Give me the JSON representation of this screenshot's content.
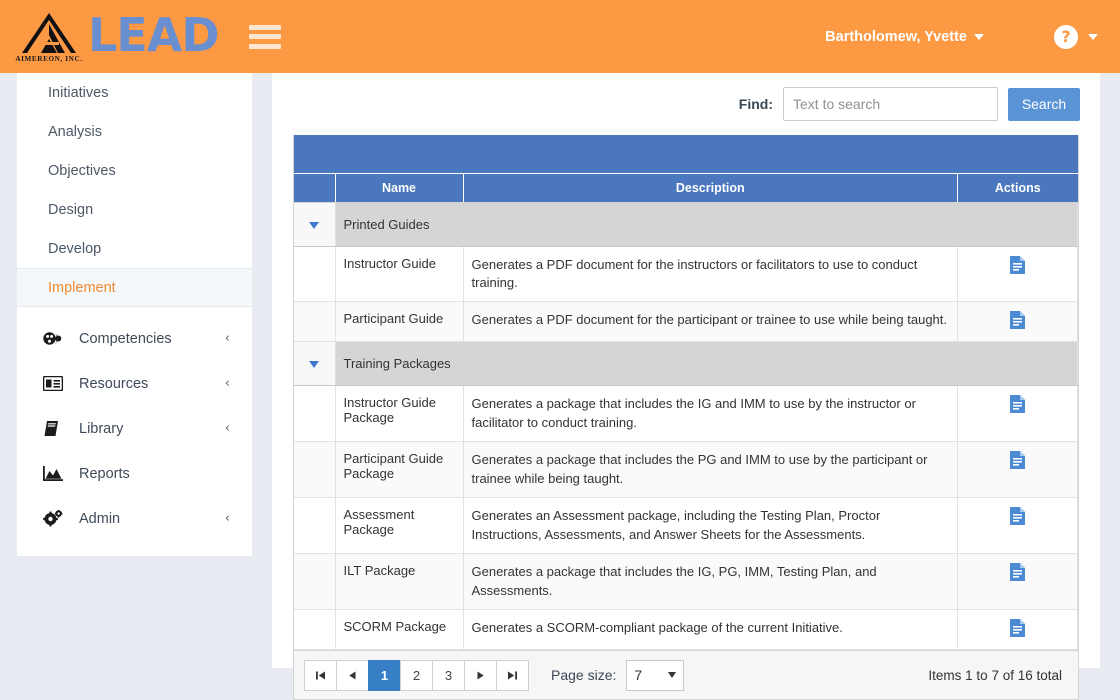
{
  "header": {
    "logo_word": "LEAD",
    "logo_company": "AIMEREON, INC.",
    "menu_icon": "hamburger-icon",
    "user_name": "Bartholomew, Yvette",
    "help_icon": "question-mark-icon",
    "brand_color": "#fd9843"
  },
  "sidebar": {
    "phase_items": [
      {
        "label": "Initiatives",
        "active": false
      },
      {
        "label": "Analysis",
        "active": false
      },
      {
        "label": "Objectives",
        "active": false
      },
      {
        "label": "Design",
        "active": false
      },
      {
        "label": "Develop",
        "active": false
      },
      {
        "label": "Implement",
        "active": true
      }
    ],
    "section_items": [
      {
        "label": "Competencies",
        "icon": "competencies-icon",
        "chevron": "‹"
      },
      {
        "label": "Resources",
        "icon": "id-card-icon",
        "chevron": "‹"
      },
      {
        "label": "Library",
        "icon": "book-icon",
        "chevron": "‹"
      },
      {
        "label": "Reports",
        "icon": "chart-area-icon",
        "chevron": ""
      },
      {
        "label": "Admin",
        "icon": "cogs-icon",
        "chevron": "‹"
      }
    ],
    "active_color": "#f08b33"
  },
  "search": {
    "find_label": "Find:",
    "placeholder": "Text to search",
    "value": "",
    "button_label": "Search",
    "button_color": "#5b94d6"
  },
  "grid": {
    "header_color": "#4a77be",
    "columns": {
      "toggle": "",
      "name": "Name",
      "description": "Description",
      "actions": "Actions"
    },
    "groups": [
      {
        "title": "Printed Guides",
        "toggle_icon": "caret-down-icon",
        "rows": [
          {
            "name": "Instructor Guide",
            "description": "Generates a PDF document for the instructors or facilitators to use to conduct training.",
            "action_icon": "file-document-icon"
          },
          {
            "name": "Participant Guide",
            "description": "Generates a PDF document for the participant or trainee to use while being taught.",
            "action_icon": "file-document-icon"
          }
        ]
      },
      {
        "title": "Training Packages",
        "toggle_icon": "caret-down-icon",
        "rows": [
          {
            "name": "Instructor Guide Package",
            "description": "Generates a package that includes the IG and IMM to use by the instructor or facilitator to conduct training.",
            "action_icon": "file-document-icon"
          },
          {
            "name": "Participant Guide Package",
            "description": "Generates a package that includes the PG and IMM to use by the participant or trainee while being taught.",
            "action_icon": "file-document-icon"
          },
          {
            "name": "Assessment Package",
            "description": "Generates an Assessment package, including the Testing Plan, Proctor Instructions, Assessments, and Answer Sheets for the Assessments.",
            "action_icon": "file-document-icon"
          },
          {
            "name": "ILT Package",
            "description": "Generates a package that includes the IG, PG, IMM, Testing Plan, and Assessments.",
            "action_icon": "file-document-icon"
          },
          {
            "name": "SCORM Package",
            "description": "Generates a SCORM-compliant package of the current Initiative.",
            "action_icon": "file-document-icon"
          }
        ]
      }
    ]
  },
  "pager": {
    "first_label": "⏮",
    "prev_label": "◀",
    "next_label": "▶",
    "last_label": "⏭",
    "pages": [
      "1",
      "2",
      "3"
    ],
    "current_page": "1",
    "page_size_label": "Page size:",
    "page_size_value": "7",
    "items_total_text": "Items 1 to 7 of 16 total"
  }
}
